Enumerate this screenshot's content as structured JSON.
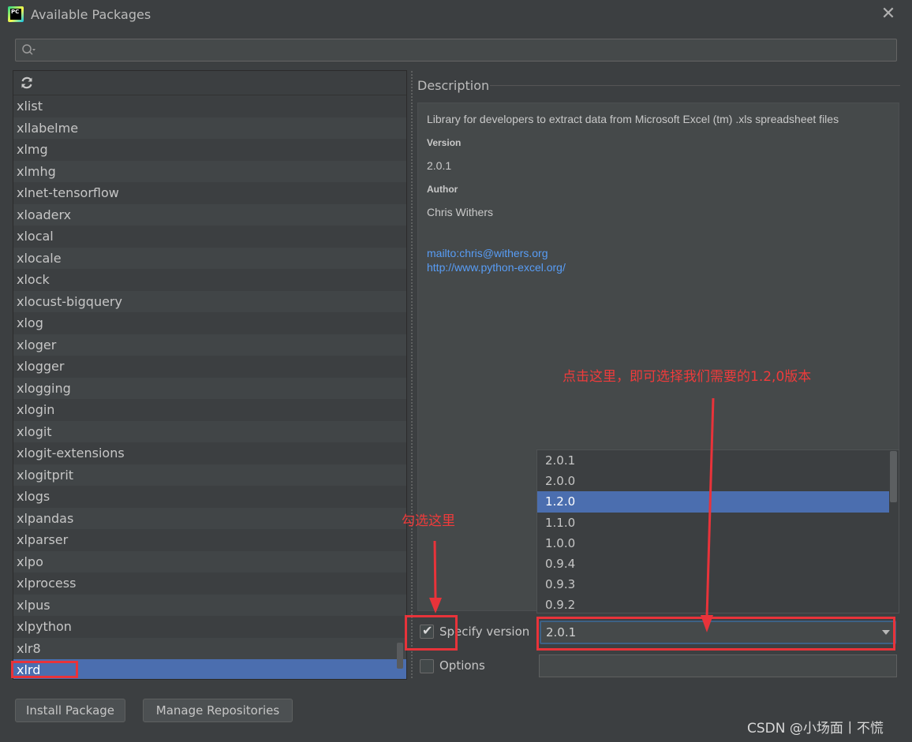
{
  "window": {
    "app_icon_text": "PC",
    "title": "Available Packages",
    "close_label": "✕"
  },
  "search": {
    "placeholder": "",
    "value": ""
  },
  "package_list": {
    "items": [
      "xlist",
      "xllabelme",
      "xlmg",
      "xlmhg",
      "xlnet-tensorflow",
      "xloaderx",
      "xlocal",
      "xlocale",
      "xlock",
      "xlocust-bigquery",
      "xlog",
      "xloger",
      "xlogger",
      "xlogging",
      "xlogin",
      "xlogit",
      "xlogit-extensions",
      "xlogitprit",
      "xlogs",
      "xlpandas",
      "xlparser",
      "xlpo",
      "xlprocess",
      "xlpus",
      "xlpython",
      "xlr8",
      "xlrd"
    ],
    "selected": "xlrd"
  },
  "description": {
    "header": "Description",
    "summary": "Library for developers to extract data from Microsoft Excel (tm) .xls spreadsheet files",
    "version_label": "Version",
    "version_value": "2.0.1",
    "author_label": "Author",
    "author_value": "Chris Withers",
    "link_email": "mailto:chris@withers.org",
    "link_home": "http://www.python-excel.org/"
  },
  "version_popup": {
    "items": [
      "2.0.1",
      "2.0.0",
      "1.2.0",
      "1.1.0",
      "1.0.0",
      "0.9.4",
      "0.9.3",
      "0.9.2"
    ],
    "highlighted": "1.2.0"
  },
  "specify_version": {
    "label": "Specify version",
    "checked": true,
    "selected_value": "2.0.1"
  },
  "options": {
    "label": "Options",
    "checked": false,
    "value": ""
  },
  "buttons": {
    "install": "Install Package",
    "manage": "Manage Repositories"
  },
  "annotations": {
    "top_note": "点击这里，即可选择我们需要的1.2,0版本",
    "check_note": "勾选这里",
    "color": "#e8333a"
  },
  "watermark": "CSDN @小场面丨不慌"
}
